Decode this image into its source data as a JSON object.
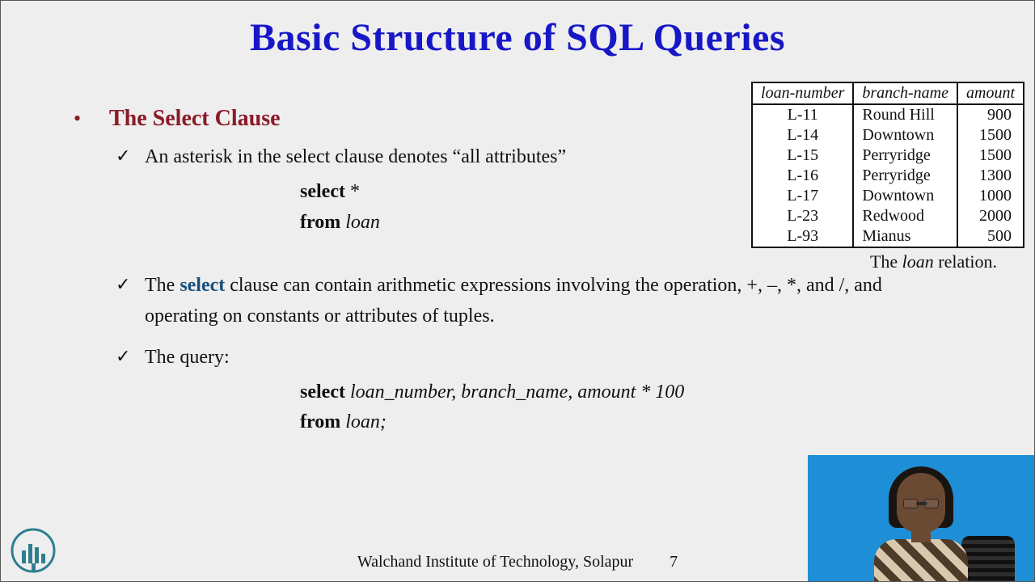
{
  "title": "Basic Structure of SQL Queries",
  "section_heading": "The Select Clause",
  "points": {
    "p1": "An asterisk in the select clause denotes “all attributes”",
    "p2_pre": "The ",
    "p2_sel": "select",
    "p2_post": " clause can contain arithmetic expressions involving the operation, +, –, *, and /, and operating on constants or attributes of tuples.",
    "p3": "The query:"
  },
  "code1": {
    "l1_kw": "select",
    "l1_rest": " *",
    "l2_kw": "from",
    "l2_rest": " loan"
  },
  "code2": {
    "l1_kw": "select",
    "l1_rest": " loan_number, branch_name, amount * 100",
    "l2_kw": "from",
    "l2_rest": " loan;"
  },
  "table": {
    "headers": [
      "loan-number",
      "branch-name",
      "amount"
    ],
    "rows": [
      {
        "ln": "L-11",
        "bn": "Round Hill",
        "amt": "900"
      },
      {
        "ln": "L-14",
        "bn": "Downtown",
        "amt": "1500"
      },
      {
        "ln": "L-15",
        "bn": "Perryridge",
        "amt": "1500"
      },
      {
        "ln": "L-16",
        "bn": "Perryridge",
        "amt": "1300"
      },
      {
        "ln": "L-17",
        "bn": "Downtown",
        "amt": "1000"
      },
      {
        "ln": "L-23",
        "bn": "Redwood",
        "amt": "2000"
      },
      {
        "ln": "L-93",
        "bn": "Mianus",
        "amt": "500"
      }
    ],
    "caption_pre": "The ",
    "caption_it": "loan",
    "caption_post": " relation."
  },
  "footer": {
    "org": "Walchand Institute of Technology, Solapur",
    "page": "7"
  }
}
